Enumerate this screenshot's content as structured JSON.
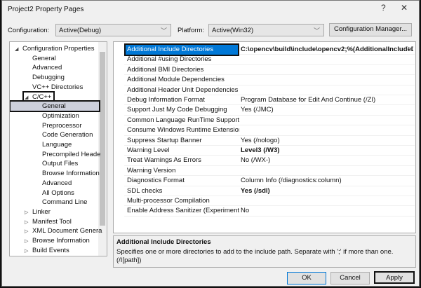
{
  "window": {
    "title": "Project2 Property Pages",
    "help": "?",
    "close": "✕"
  },
  "toolbar": {
    "configuration_label": "Configuration:",
    "configuration_value": "Active(Debug)",
    "platform_label": "Platform:",
    "platform_value": "Active(Win32)",
    "config_manager": "Configuration Manager..."
  },
  "tree": [
    {
      "label": "Configuration Properties",
      "level": 0,
      "exp": "◢"
    },
    {
      "label": "General",
      "level": 1
    },
    {
      "label": "Advanced",
      "level": 1
    },
    {
      "label": "Debugging",
      "level": 1
    },
    {
      "label": "VC++ Directories",
      "level": 1
    },
    {
      "label": "C/C++",
      "level": 1,
      "exp": "◢",
      "boxed": true
    },
    {
      "label": "General",
      "level": 2,
      "selected": true
    },
    {
      "label": "Optimization",
      "level": 2
    },
    {
      "label": "Preprocessor",
      "level": 2
    },
    {
      "label": "Code Generation",
      "level": 2
    },
    {
      "label": "Language",
      "level": 2
    },
    {
      "label": "Precompiled Heade",
      "level": 2
    },
    {
      "label": "Output Files",
      "level": 2
    },
    {
      "label": "Browse Information",
      "level": 2
    },
    {
      "label": "Advanced",
      "level": 2
    },
    {
      "label": "All Options",
      "level": 2
    },
    {
      "label": "Command Line",
      "level": 2
    },
    {
      "label": "Linker",
      "level": 1,
      "exp": "▷"
    },
    {
      "label": "Manifest Tool",
      "level": 1,
      "exp": "▷"
    },
    {
      "label": "XML Document Genera",
      "level": 1,
      "exp": "▷"
    },
    {
      "label": "Browse Information",
      "level": 1,
      "exp": "▷"
    },
    {
      "label": "Build Events",
      "level": 1,
      "exp": "▷"
    }
  ],
  "properties": [
    {
      "name": "Additional Include Directories",
      "value": "C:\\opencv\\build\\include\\opencv2;%(AdditionalIncludeD",
      "bold": true,
      "selected": true
    },
    {
      "name": "Additional #using Directories",
      "value": ""
    },
    {
      "name": "Additional BMI Directories",
      "value": ""
    },
    {
      "name": "Additional Module Dependencies",
      "value": ""
    },
    {
      "name": "Additional Header Unit Dependencies",
      "value": ""
    },
    {
      "name": "Debug Information Format",
      "value": "Program Database for Edit And Continue (/ZI)"
    },
    {
      "name": "Support Just My Code Debugging",
      "value": "Yes (/JMC)"
    },
    {
      "name": "Common Language RunTime Support",
      "value": ""
    },
    {
      "name": "Consume Windows Runtime Extension",
      "value": ""
    },
    {
      "name": "Suppress Startup Banner",
      "value": "Yes (/nologo)"
    },
    {
      "name": "Warning Level",
      "value": "Level3 (/W3)",
      "bold": true
    },
    {
      "name": "Treat Warnings As Errors",
      "value": "No (/WX-)"
    },
    {
      "name": "Warning Version",
      "value": ""
    },
    {
      "name": "Diagnostics Format",
      "value": "Column Info (/diagnostics:column)"
    },
    {
      "name": "SDL checks",
      "value": "Yes (/sdl)",
      "bold": true
    },
    {
      "name": "Multi-processor Compilation",
      "value": ""
    },
    {
      "name": "Enable Address Sanitizer (Experimental)",
      "value": "No"
    }
  ],
  "description": {
    "title": "Additional Include Directories",
    "text": "Specifies one or more directories to add to the include path. Separate with ';' if more than one.     (/I[path])"
  },
  "buttons": {
    "ok": "OK",
    "cancel": "Cancel",
    "apply": "Apply"
  }
}
